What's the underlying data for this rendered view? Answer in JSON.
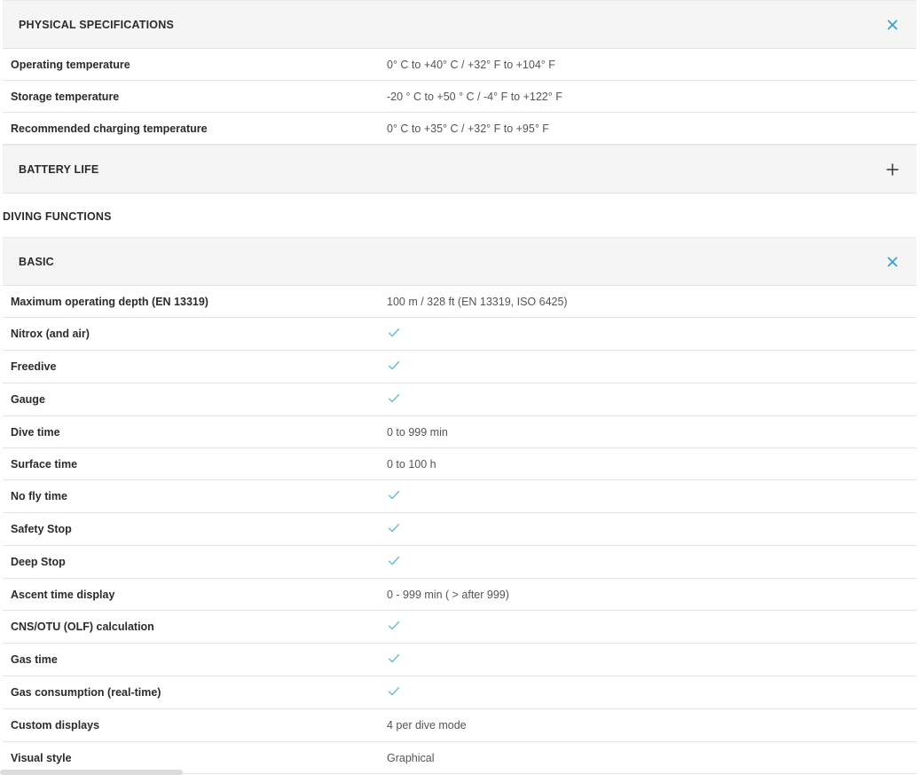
{
  "physical": {
    "title": "PHYSICAL SPECIFICATIONS",
    "icon": "close-icon",
    "rows": [
      {
        "label": "Operating temperature",
        "value": "0° C to +40° C / +32° F to +104° F"
      },
      {
        "label": "Storage temperature",
        "value": "-20 ° C to +50 ° C / -4° F to +122° F"
      },
      {
        "label": "Recommended charging temperature",
        "value": "0° C to +35° C / +32° F to +95° F"
      }
    ]
  },
  "battery": {
    "title": "BATTERY LIFE",
    "icon": "plus-icon"
  },
  "diving": {
    "title": "DIVING FUNCTIONS"
  },
  "basic": {
    "title": "BASIC",
    "icon": "close-icon",
    "rows": [
      {
        "label": "Maximum operating depth (EN 13319)",
        "value": "100 m / 328 ft (EN 13319, ISO 6425)",
        "check": false
      },
      {
        "label": "Nitrox (and air)",
        "value": "",
        "check": true
      },
      {
        "label": "Freedive",
        "value": "",
        "check": true
      },
      {
        "label": "Gauge",
        "value": "",
        "check": true
      },
      {
        "label": "Dive time",
        "value": "0 to 999 min",
        "check": false
      },
      {
        "label": "Surface time",
        "value": "0 to 100 h",
        "check": false
      },
      {
        "label": "No fly time",
        "value": "",
        "check": true
      },
      {
        "label": "Safety Stop",
        "value": "",
        "check": true
      },
      {
        "label": "Deep Stop",
        "value": "",
        "check": true
      },
      {
        "label": "Ascent time display",
        "value": "0 - 999 min ( > after 999)",
        "check": false
      },
      {
        "label": "CNS/OTU (OLF) calculation",
        "value": "",
        "check": true
      },
      {
        "label": "Gas time",
        "value": "",
        "check": true
      },
      {
        "label": "Gas consumption (real-time)",
        "value": "",
        "check": true
      },
      {
        "label": "Custom displays",
        "value": "4 per dive mode",
        "check": false
      },
      {
        "label": "Visual style",
        "value": "Graphical",
        "check": false
      }
    ]
  },
  "colors": {
    "accent": "#3aa0d0",
    "check": "#5bb8d4",
    "header_bg": "#f5f5f5",
    "divider": "#e3e3e3"
  }
}
